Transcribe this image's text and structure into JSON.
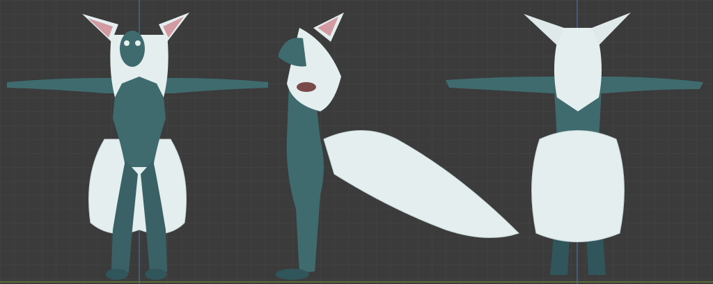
{
  "viewport": {
    "background": "#3b3b3b",
    "grid_color": "#4a4a4a",
    "axis_z_color": "#4f6d9a",
    "axis_x_color": "#6e8a3a"
  },
  "model": {
    "skin_color": "#3f6b6f",
    "skin_shade": "#30555a",
    "fur_color": "#e4eeee",
    "fur_shade": "#c3d3d4",
    "ear_inner_color": "#d49aa2",
    "claw_color": "#d9c08a",
    "views": [
      "front",
      "side",
      "back"
    ]
  }
}
